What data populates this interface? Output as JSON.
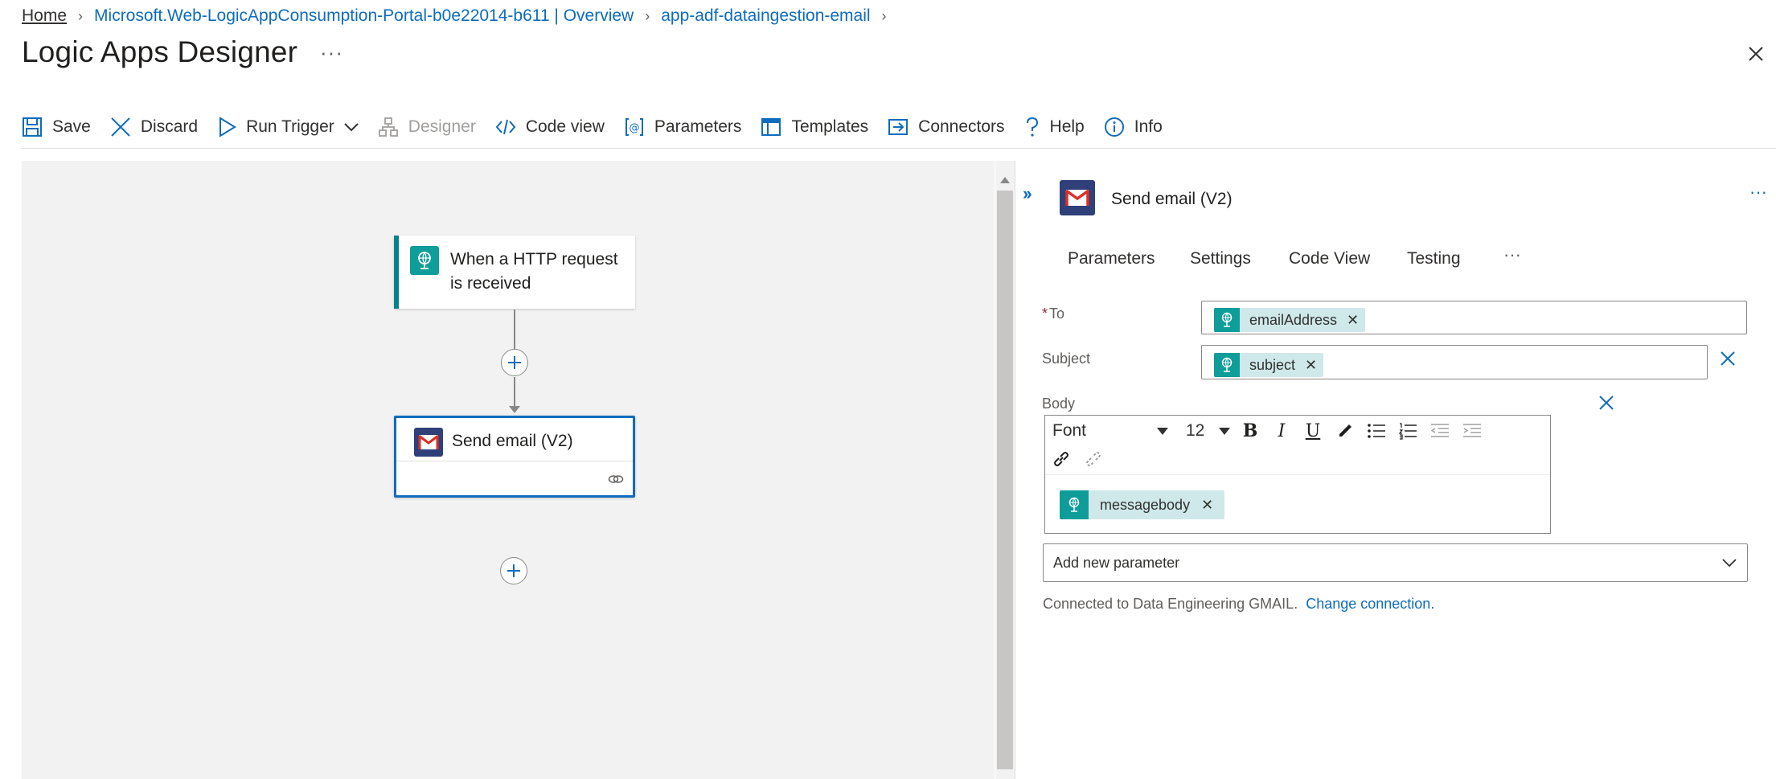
{
  "breadcrumb": {
    "items": [
      "Home",
      "Microsoft.Web-LogicAppConsumption-Portal-b0e22014-b611 | Overview",
      "app-adf-dataingestion-email"
    ]
  },
  "page": {
    "title": "Logic Apps Designer",
    "more": "···"
  },
  "toolbar": {
    "save": "Save",
    "discard": "Discard",
    "run_trigger": "Run Trigger",
    "designer": "Designer",
    "code_view": "Code view",
    "parameters": "Parameters",
    "templates": "Templates",
    "connectors": "Connectors",
    "help": "Help",
    "info": "Info"
  },
  "canvas": {
    "trigger": {
      "title": "When a HTTP request is received",
      "icon": "request-icon"
    },
    "action": {
      "title": "Send email (V2)",
      "icon": "gmail-icon"
    }
  },
  "panel": {
    "title": "Send email (V2)",
    "more": "···",
    "tabs": [
      "Parameters",
      "Settings",
      "Code View",
      "Testing"
    ],
    "tabs_more": "···",
    "fields": {
      "to": {
        "label": "To",
        "required_mark": "*",
        "token": "emailAddress"
      },
      "subject": {
        "label": "Subject",
        "token": "subject"
      },
      "body": {
        "label": "Body",
        "token": "messagebody",
        "font": "Font",
        "size": "12"
      }
    },
    "add_parameter": "Add new parameter",
    "connection_text": "Connected to Data Engineering GMAIL.",
    "change_connection": "Change connection."
  },
  "colors": {
    "accent": "#0f6cbd",
    "teal": "#0f9d9a",
    "gmail_bg": "#2f3f7a",
    "gmail_red": "#d93025"
  }
}
